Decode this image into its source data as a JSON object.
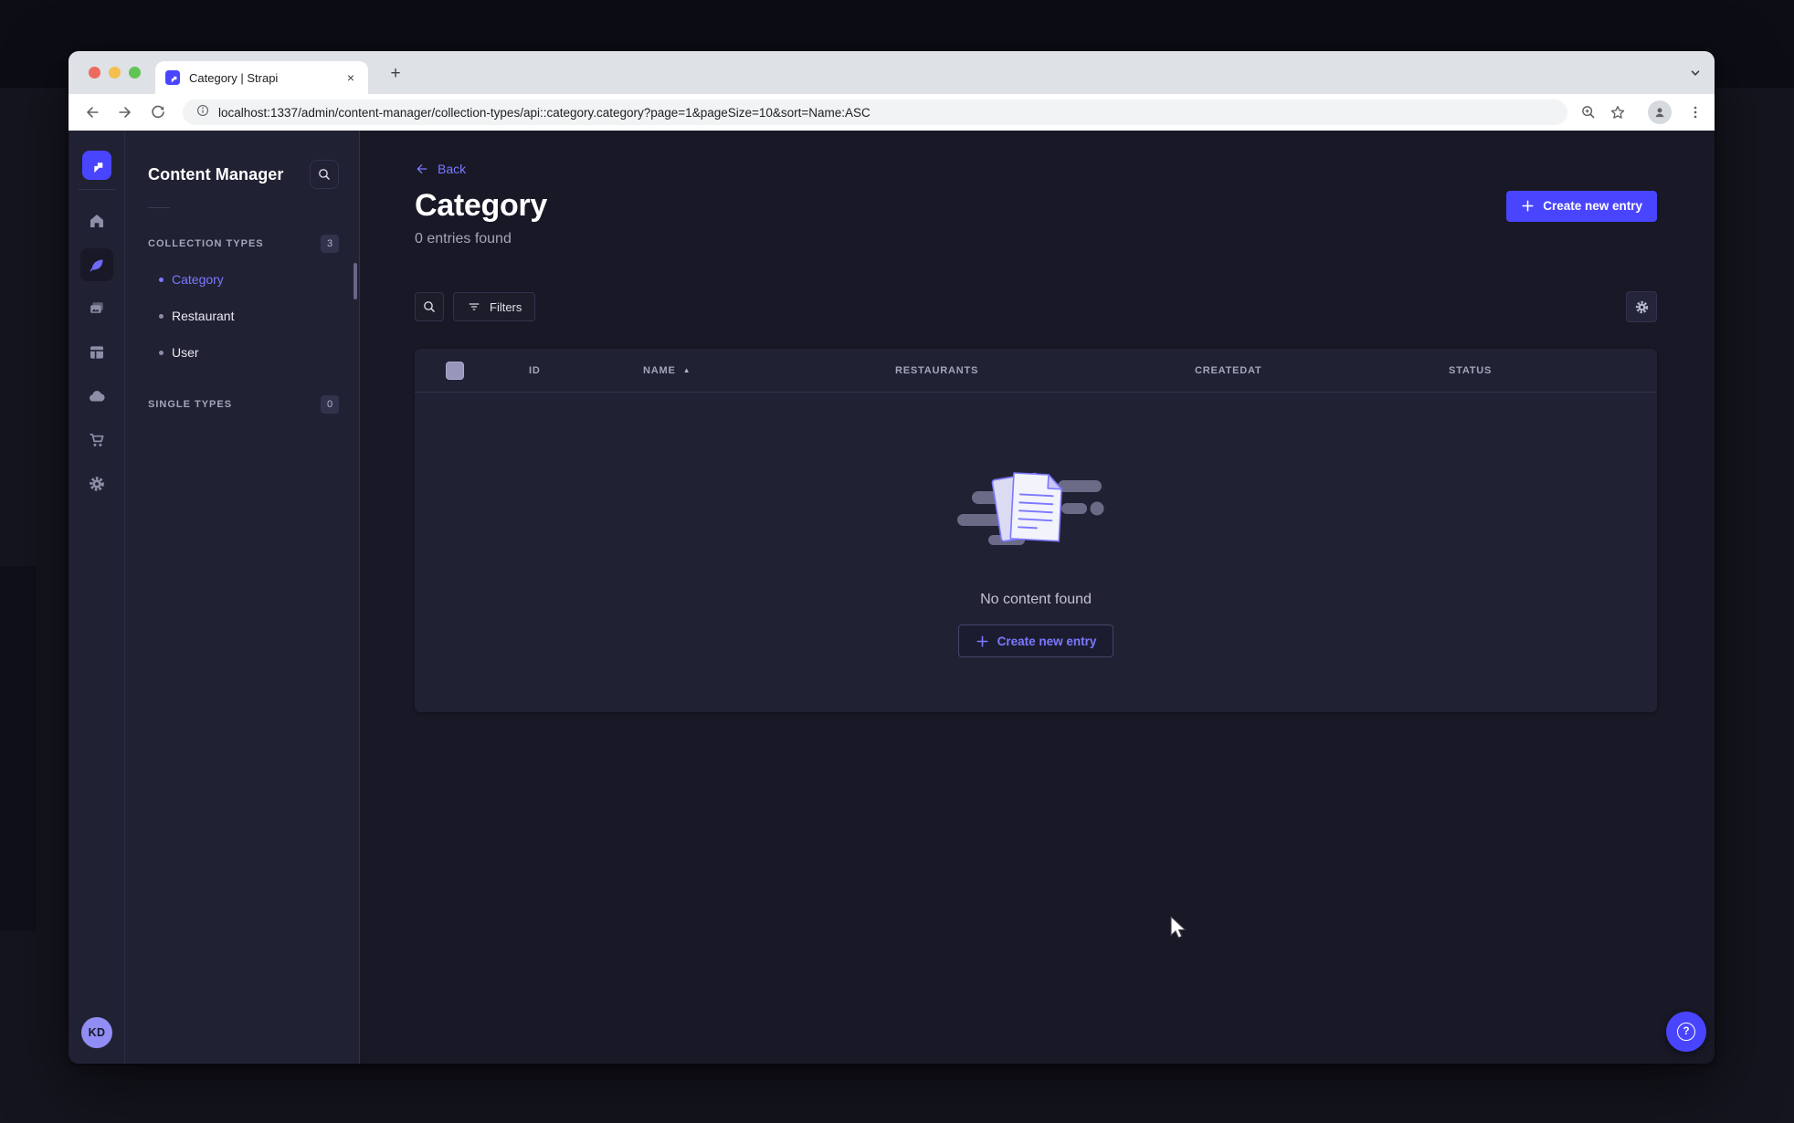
{
  "browser": {
    "tab_title": "Category | Strapi",
    "url": "localhost:1337/admin/content-manager/collection-types/api::category.category?page=1&pageSize=10&sort=Name:ASC"
  },
  "rail": {
    "avatar_initials": "KD",
    "icon_names": [
      "strapi-logo",
      "home",
      "content-manager",
      "media-library",
      "content-type-builder",
      "cloud",
      "marketplace",
      "settings"
    ],
    "active_icon": "content-manager"
  },
  "subnav": {
    "title": "Content Manager",
    "sections": [
      {
        "label": "COLLECTION TYPES",
        "badge": "3",
        "items": [
          {
            "label": "Category",
            "active": true
          },
          {
            "label": "Restaurant",
            "active": false
          },
          {
            "label": "User",
            "active": false
          }
        ]
      },
      {
        "label": "SINGLE TYPES",
        "badge": "0",
        "items": []
      }
    ]
  },
  "main": {
    "back": "Back",
    "title": "Category",
    "entries_count": "0 entries found",
    "create_entry": "Create new entry",
    "filters": "Filters",
    "table": {
      "columns": [
        "ID",
        "NAME",
        "RESTAURANTS",
        "CREATEDAT",
        "STATUS"
      ],
      "sort": {
        "column": "NAME",
        "direction": "ascending"
      },
      "rows": []
    },
    "empty": {
      "message": "No content found",
      "cta": "Create new entry"
    }
  },
  "icons": {
    "close": "×",
    "new_tab": "+",
    "sort_ascending": "▲",
    "question_mark": "?"
  },
  "colors": {
    "accent": "#4945ff",
    "accent_light": "#7b79ff",
    "app_background": "#181826",
    "panel_background": "#212134",
    "border": "#32324d",
    "text_muted": "#a5a5ba"
  }
}
